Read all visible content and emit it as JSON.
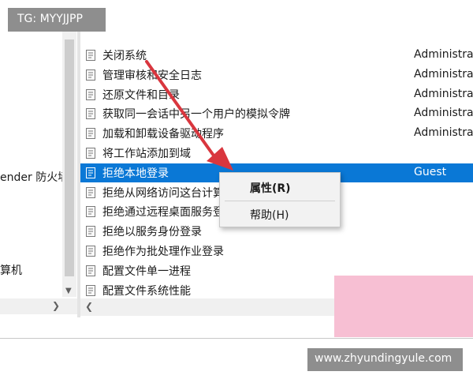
{
  "watermark": {
    "tg": "TG: MYYJJPP",
    "site": "www.zhyundingyule.com"
  },
  "left_pane": {
    "items": [
      "ender 防火墙",
      "算机"
    ]
  },
  "policies": [
    {
      "name": "关闭系统",
      "value": "Administra",
      "selected": false
    },
    {
      "name": "管理审核和安全日志",
      "value": "Administra",
      "selected": false
    },
    {
      "name": "还原文件和目录",
      "value": "Administra",
      "selected": false
    },
    {
      "name": "获取同一会话中另一个用户的模拟令牌",
      "value": "Administra",
      "selected": false
    },
    {
      "name": "加载和卸载设备驱动程序",
      "value": "Administra",
      "selected": false
    },
    {
      "name": "将工作站添加到域",
      "value": "",
      "selected": false
    },
    {
      "name": "拒绝本地登录",
      "value": "Guest",
      "selected": true
    },
    {
      "name": "拒绝从网络访问这台计算机",
      "value": "",
      "selected": false
    },
    {
      "name": "拒绝通过远程桌面服务登录",
      "value": "",
      "selected": false
    },
    {
      "name": "拒绝以服务身份登录",
      "value": "",
      "selected": false
    },
    {
      "name": "拒绝作为批处理作业登录",
      "value": "",
      "selected": false
    },
    {
      "name": "配置文件单一进程",
      "value": "",
      "selected": false
    },
    {
      "name": "配置文件系统性能",
      "value": "",
      "selected": false
    }
  ],
  "context_menu": {
    "items": [
      "属性(R)",
      "帮助(H)"
    ]
  },
  "colors": {
    "selection": "#0a78d6",
    "arrow": "#d9363e",
    "pink": "#f7bfd3"
  },
  "icons": {
    "policy": "policy-doc-icon",
    "scroll_down": "arrow-down-icon",
    "scroll_left": "arrow-left-icon",
    "scroll_right": "arrow-right-icon"
  }
}
